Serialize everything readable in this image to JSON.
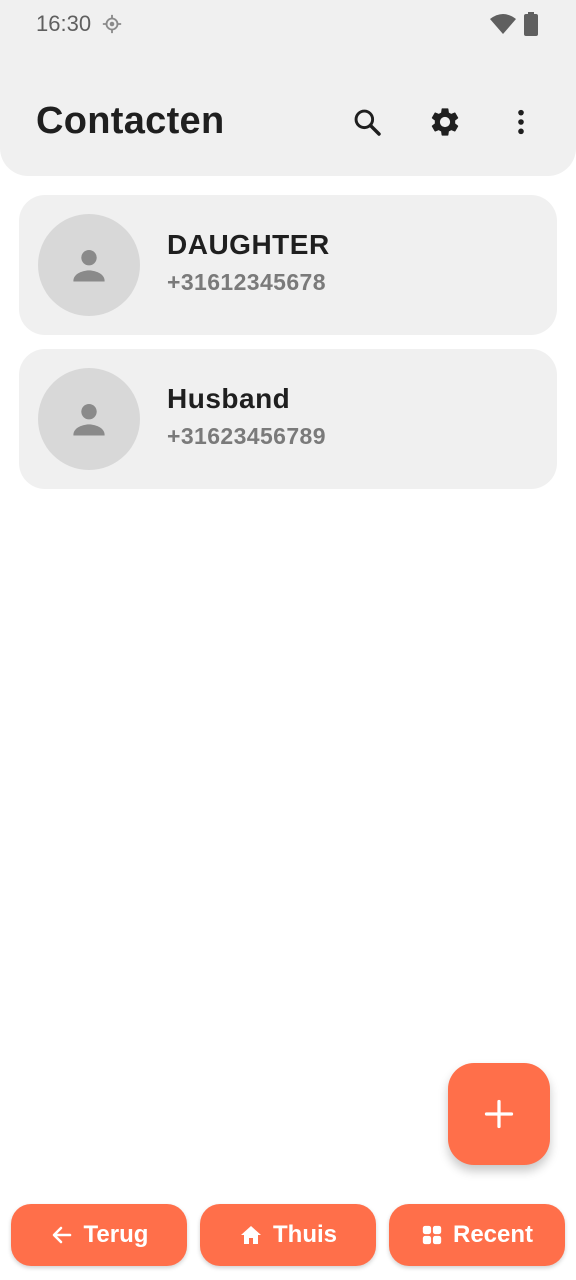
{
  "status_bar": {
    "time": "16:30",
    "icons": [
      "location-icon",
      "wifi-icon",
      "battery-icon"
    ]
  },
  "header": {
    "title": "Contacten",
    "actions": [
      "search-icon",
      "gear-icon",
      "more-vert-icon"
    ]
  },
  "contacts": [
    {
      "name": "DAUGHTER",
      "phone": "+31612345678",
      "avatar_icon": "person-icon"
    },
    {
      "name": "Husband",
      "phone": "+31623456789",
      "avatar_icon": "person-icon"
    }
  ],
  "fab": {
    "icon": "plus-icon"
  },
  "bottom_nav": [
    {
      "label": "Terug",
      "icon": "arrow-left-icon"
    },
    {
      "label": "Thuis",
      "icon": "home-icon"
    },
    {
      "label": "Recent",
      "icon": "grid-icon"
    }
  ],
  "colors": {
    "accent": "#ff6f4a",
    "surface": "#f0f0f0",
    "avatar_bg": "#d8d8d8",
    "text_primary": "#1f1f1f",
    "text_secondary": "#7a7a7a"
  }
}
